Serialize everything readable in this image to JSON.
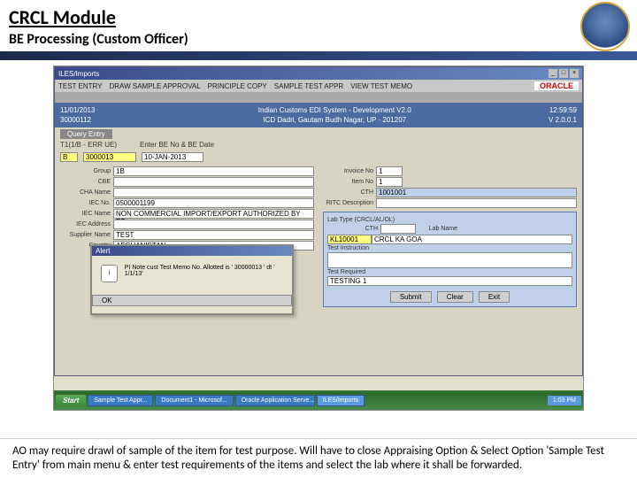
{
  "slide": {
    "title": "CRCL Module",
    "subtitle": "BE Processing (Custom Officer)"
  },
  "app": {
    "window_title": "ILES/Imports",
    "menubar": [
      "TEST ENTRY",
      "DRAW SAMPLE APPROVAL",
      "PRINCIPLE COPY",
      "SAMPLE TEST APPR",
      "VIEW TEST MEMO"
    ],
    "brand": "ORACLE"
  },
  "header": {
    "date": "11/01/2013",
    "user_id": "30000112",
    "sys_line1": "Indian Customs EDI System - Development V2.0",
    "sys_line2": "ICD Dadri, Gautam Budh Nagar, UP - 201207",
    "time": "12:59:59",
    "version": "V 2.0.0.1"
  },
  "query": {
    "section": "Query Entry",
    "label1": "T1(1/B - ERR UE)",
    "label2": "Enter BE No & BE Date",
    "val1": "B",
    "val2": "3000013",
    "val3": "10-JAN-2013"
  },
  "left": {
    "group": "1B",
    "cbe": "",
    "cha_name": "",
    "iec_no": "0500001199",
    "iec_name": "NON COMMERCIAL IMPORT/EXPORT AUTHORIZED BY RB",
    "iec_address": "",
    "supplier_name": "TEST",
    "country": "AFGHANISTAN"
  },
  "right": {
    "invoice_no": "1",
    "item_no": "1",
    "cth": "1001001",
    "ritc_desc": "",
    "lab_type": "Lab Type (CRCL/AL/OL)",
    "cth2": "",
    "lab_code": "KL10001",
    "lab_name": "CRCL KA GOA",
    "test_instruction": "",
    "test_required": "",
    "test_val": "TESTING 1"
  },
  "alert": {
    "title": "Alert",
    "message": "PI Note cust Test Memo No. Allotted is ' 30000013 ' dt ' 1/1/13'",
    "ok": "OK"
  },
  "buttons": {
    "submit": "Submit",
    "clear": "Clear",
    "exit": "Exit"
  },
  "taskbar": {
    "start": "Start",
    "items": [
      "Sample Test Appr...",
      "Document1 - Microsof...",
      "Oracle Application Serve...",
      "ILES/Imports"
    ],
    "tray": "1:03 PM"
  },
  "footer": "AO may require drawl of sample of the item for test purpose. Will have to close Appraising Option & Select Option 'Sample Test Entry' from main menu & enter test requirements of the items and select the lab where it shall be forwarded."
}
